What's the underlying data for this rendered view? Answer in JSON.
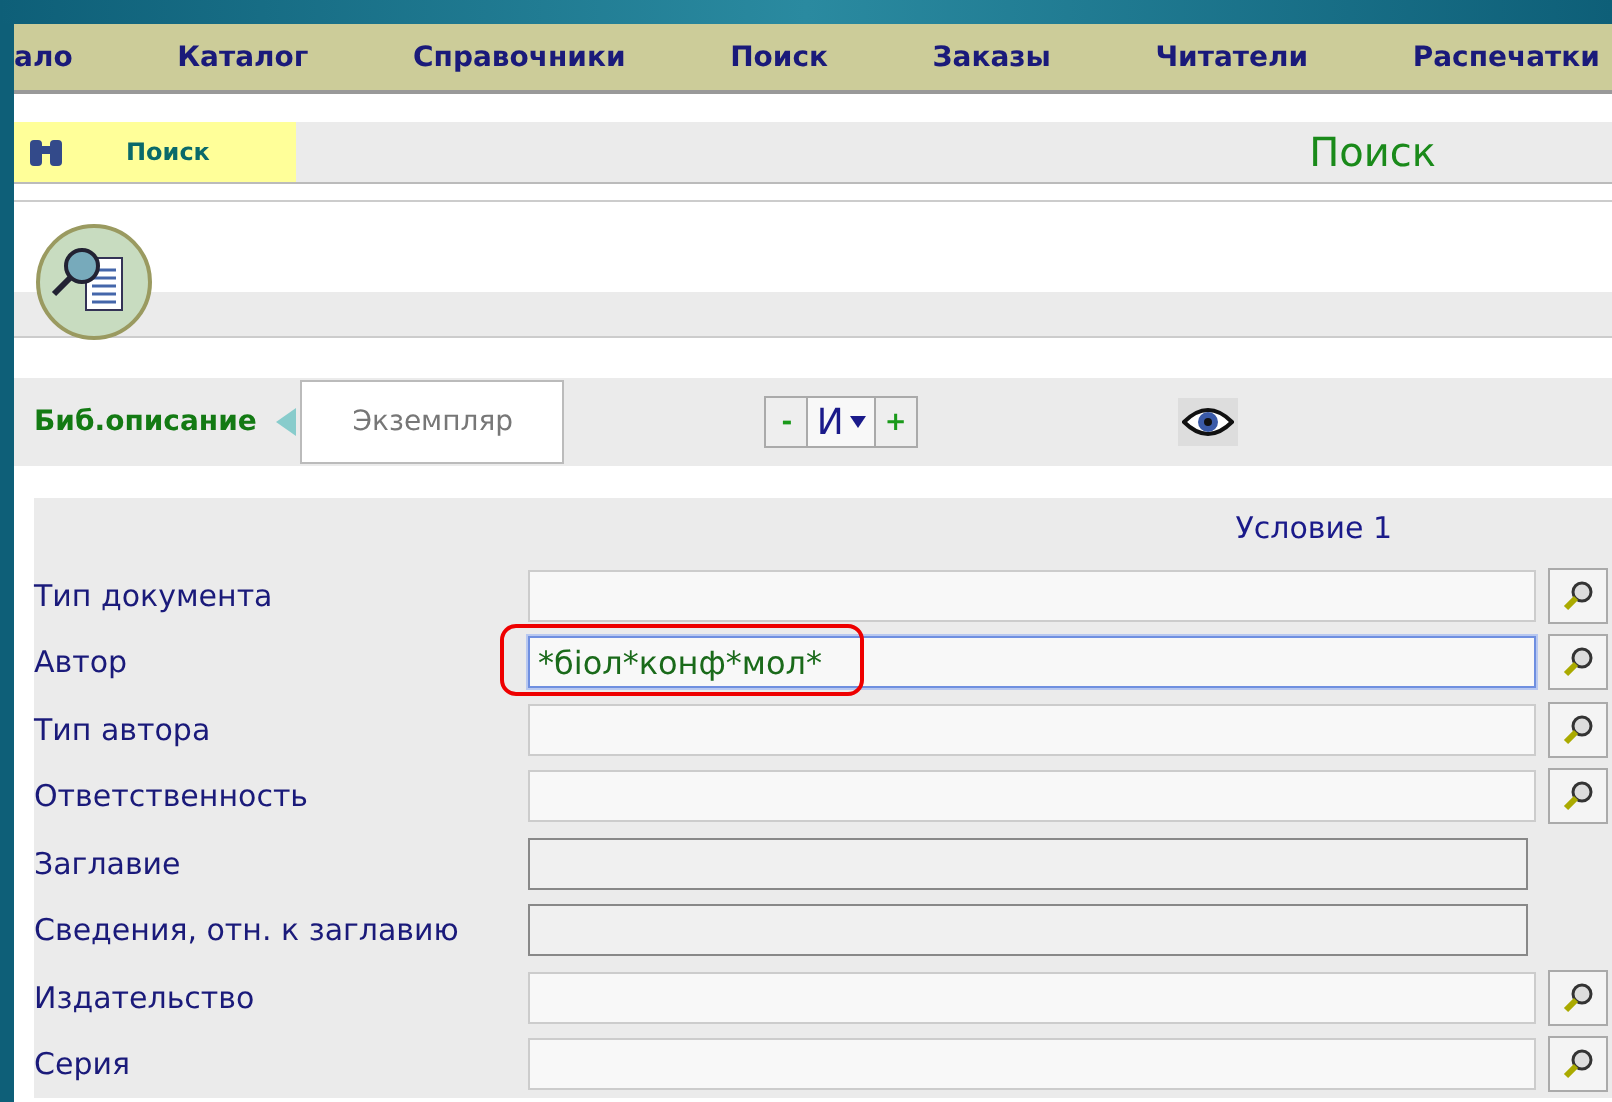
{
  "menu": [
    "ало",
    "Каталог",
    "Справочники",
    "Поиск",
    "Заказы",
    "Читатели",
    "Распечатки"
  ],
  "section": {
    "label": "Поиск",
    "title": "Поиск"
  },
  "tabs": [
    {
      "label": "Биб.описание",
      "selected": true
    },
    {
      "label": "Экземпляр",
      "selected": false
    }
  ],
  "operator": {
    "minus": "-",
    "value": "И",
    "plus": "+"
  },
  "condition": {
    "title": "Условие 1"
  },
  "fields": [
    {
      "label": "Тип документа",
      "kind": "lookup",
      "focused": false,
      "circled": false
    },
    {
      "label": "Автор",
      "kind": "lookup",
      "value": "*біол*конф*мол*",
      "focused": true,
      "circled": true
    },
    {
      "label": "Тип автора",
      "kind": "lookup",
      "focused": false,
      "circled": false
    },
    {
      "label": "Ответственность",
      "kind": "lookup",
      "focused": false,
      "circled": false
    },
    {
      "label": "Заглавие",
      "kind": "readonly"
    },
    {
      "label": "Сведения, отн. к заглавию",
      "kind": "readonly"
    },
    {
      "label": "Издательство",
      "kind": "lookup",
      "focused": false,
      "circled": false
    },
    {
      "label": "Серия",
      "kind": "lookup",
      "focused": false,
      "circled": false
    }
  ]
}
